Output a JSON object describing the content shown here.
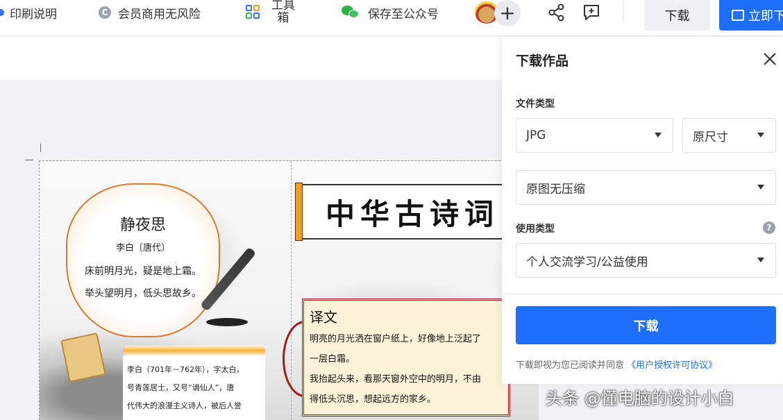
{
  "toolbar": {
    "print_guide": "印刷说明",
    "commercial": "会员商用无风险",
    "commercial_icon_letter": "C",
    "tools_line1": "工具",
    "tools_line2": "箱",
    "save_official": "保存至公众号",
    "add_symbol": "+",
    "download": "下载",
    "print_now": "立即下"
  },
  "poster": {
    "title": "中华古诗词",
    "poem_title": "静夜思",
    "poem_author": "李白〔唐代〕",
    "poem_lines": [
      "床前明月光，疑是地上霜。",
      "举头望明月，低头思故乡。"
    ],
    "bio_lines": [
      "李白（701年－762年），字太白，",
      "号青莲居士，又号“谪仙人”，唐",
      "代伟大的浪漫主义诗人，被后人誉"
    ],
    "translation_title": "译文",
    "translation_lines": [
      "明亮的月光洒在窗户纸上，好像地上泛起了",
      "一层白霜。",
      "我抬起头来，看那天窗外空中的明月，不由",
      "得低头沉思，想起远方的家乡。"
    ]
  },
  "panel": {
    "title": "下载作品",
    "file_type_label": "文件类型",
    "format": "JPG",
    "size": "原尺寸",
    "compression": "原图无压缩",
    "usage_label": "使用类型",
    "usage": "个人交流学习/公益使用",
    "help_symbol": "?",
    "download_button": "下载",
    "agree_text": "下载即视为您已阅读并同意",
    "agree_link": "《用户授权许可协议》"
  },
  "watermark": "头条 @懂电脑的设计小白",
  "colors": {
    "primary": "#1f6fff",
    "accent_orange": "#f0a020",
    "seal_red": "#a01a1a"
  }
}
